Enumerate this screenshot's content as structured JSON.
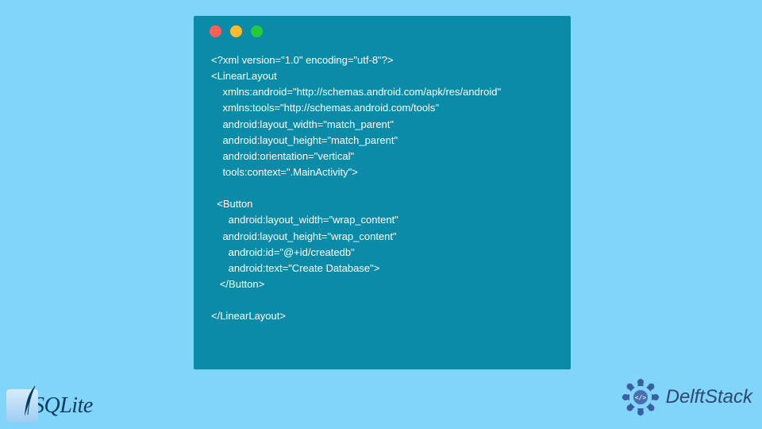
{
  "code": {
    "lines": [
      "<?xml version=\"1.0\" encoding=\"utf-8\"?>",
      "<LinearLayout",
      "    xmlns:android=\"http://schemas.android.com/apk/res/android\"",
      "    xmlns:tools=\"http://schemas.android.com/tools\"",
      "    android:layout_width=\"match_parent\"",
      "    android:layout_height=\"match_parent\"",
      "    android:orientation=\"vertical\"",
      "    tools:context=\".MainActivity\">",
      "",
      "  <Button",
      "      android:layout_width=\"wrap_content\"",
      "    android:layout_height=\"wrap_content\"",
      "      android:id=\"@+id/createdb\"",
      "      android:text=\"Create Database\">",
      "   </Button>",
      "",
      "</LinearLayout>"
    ]
  },
  "logos": {
    "sqlite": "SQLite",
    "delftstack": "DelftStack"
  }
}
